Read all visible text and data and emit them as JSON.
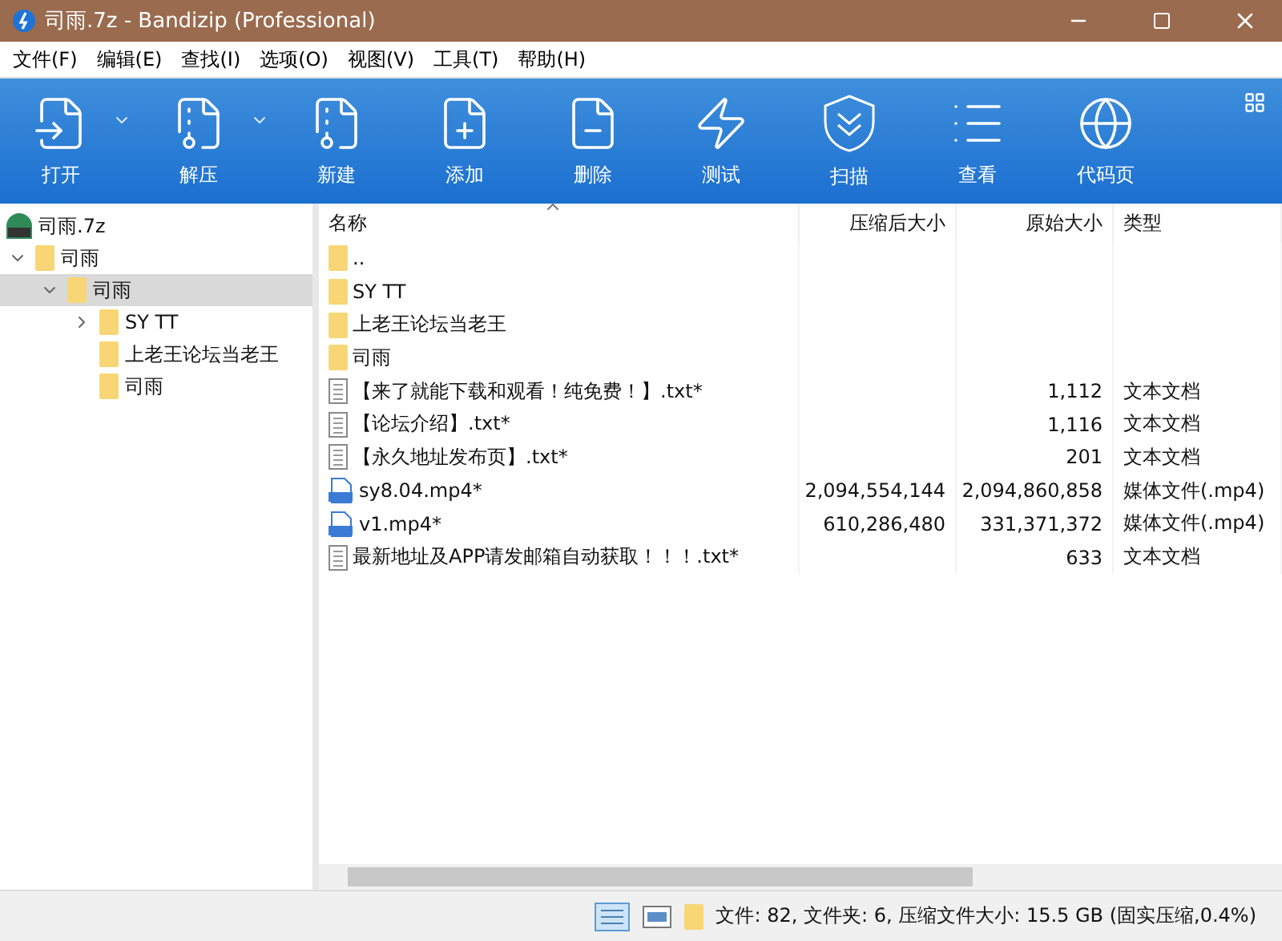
{
  "window": {
    "title": "司雨.7z - Bandizip (Professional)"
  },
  "menu": [
    "文件(F)",
    "编辑(E)",
    "查找(I)",
    "选项(O)",
    "视图(V)",
    "工具(T)",
    "帮助(H)"
  ],
  "toolbar": [
    {
      "label": "打开",
      "kind": "open",
      "dropdown": true
    },
    {
      "label": "解压",
      "kind": "extract",
      "dropdown": true
    },
    {
      "label": "新建",
      "kind": "new",
      "dropdown": false
    },
    {
      "label": "添加",
      "kind": "add",
      "dropdown": false
    },
    {
      "label": "删除",
      "kind": "delete",
      "dropdown": false
    },
    {
      "label": "测试",
      "kind": "test",
      "dropdown": false
    },
    {
      "label": "扫描",
      "kind": "scan",
      "dropdown": false
    },
    {
      "label": "查看",
      "kind": "view",
      "dropdown": false
    },
    {
      "label": "代码页",
      "kind": "codepage",
      "dropdown": false
    }
  ],
  "tree": {
    "label": "司雨.7z",
    "children": [
      {
        "label": "司雨",
        "expanded": true,
        "selected": false,
        "children": [
          {
            "label": "司雨",
            "expanded": true,
            "selected": true,
            "children": [
              {
                "label": "SY TT",
                "expanded": false,
                "selected": false,
                "has_children": true
              },
              {
                "label": "上老王论坛当老王",
                "expanded": false,
                "selected": false,
                "has_children": false
              },
              {
                "label": "司雨",
                "expanded": false,
                "selected": false,
                "has_children": false
              }
            ]
          }
        ]
      }
    ]
  },
  "table": {
    "columns": [
      "名称",
      "压缩后大小",
      "原始大小",
      "类型"
    ],
    "rows": [
      {
        "kind": "folder",
        "name": "..",
        "packed": "",
        "size": "",
        "type": ""
      },
      {
        "kind": "folder",
        "name": "SY TT",
        "packed": "",
        "size": "",
        "type": ""
      },
      {
        "kind": "folder",
        "name": "上老王论坛当老王",
        "packed": "",
        "size": "",
        "type": ""
      },
      {
        "kind": "folder",
        "name": "司雨",
        "packed": "",
        "size": "",
        "type": ""
      },
      {
        "kind": "text",
        "name": "【来了就能下载和观看！纯免费！】.txt*",
        "packed": "",
        "size": "1,112",
        "type": "文本文档"
      },
      {
        "kind": "text",
        "name": "【论坛介绍】.txt*",
        "packed": "",
        "size": "1,116",
        "type": "文本文档"
      },
      {
        "kind": "text",
        "name": "【永久地址发布页】.txt*",
        "packed": "",
        "size": "201",
        "type": "文本文档"
      },
      {
        "kind": "video",
        "name": "sy8.04.mp4*",
        "packed": "2,094,554,144",
        "size": "2,094,860,858",
        "type": "媒体文件(.mp4)"
      },
      {
        "kind": "video",
        "name": "v1.mp4*",
        "packed": "610,286,480",
        "size": "331,371,372",
        "type": "媒体文件(.mp4)"
      },
      {
        "kind": "text",
        "name": "最新地址及APP请发邮箱自动获取！！！.txt*",
        "packed": "",
        "size": "633",
        "type": "文本文档"
      }
    ]
  },
  "status_bar": {
    "text": "文件: 82, 文件夹: 6, 压缩文件大小: 15.5 GB (固实压缩,0.4%)"
  }
}
